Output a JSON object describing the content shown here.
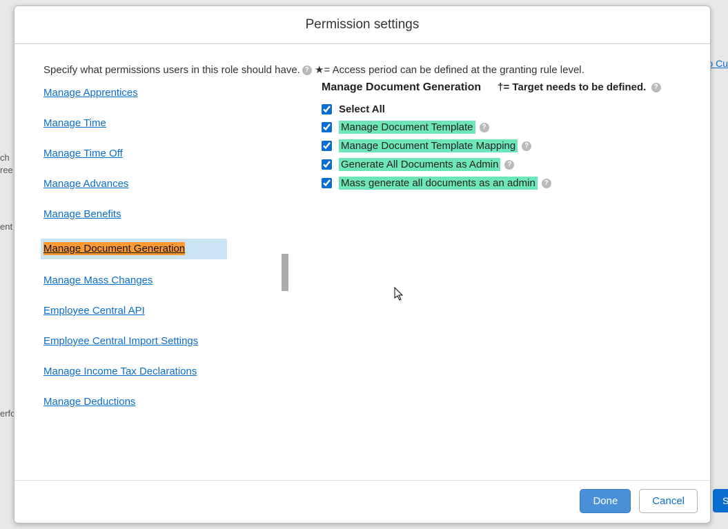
{
  "background": {
    "text_left_1": "ch",
    "text_left_2": "ree",
    "text_left_3": "ent",
    "text_left_4": "erfo",
    "link_right": "To Cu",
    "button_right": "S"
  },
  "modal": {
    "title": "Permission settings",
    "intro_prefix": "Specify what permissions users in this role should have.",
    "intro_legend": " ★= Access period can be defined at the granting rule level."
  },
  "categories": [
    {
      "label": "Manage Apprentices",
      "active": false
    },
    {
      "label": "Manage Time",
      "active": false
    },
    {
      "label": "Manage Time Off",
      "active": false
    },
    {
      "label": "Manage Advances",
      "active": false
    },
    {
      "label": "Manage Benefits",
      "active": false
    },
    {
      "label": "Manage Document Generation",
      "active": true
    },
    {
      "label": "Manage Mass Changes",
      "active": false
    },
    {
      "label": "Employee Central API",
      "active": false
    },
    {
      "label": "Employee Central Import Settings",
      "active": false
    },
    {
      "label": "Manage Income Tax Declarations",
      "active": false
    },
    {
      "label": "Manage Deductions",
      "active": false
    }
  ],
  "section": {
    "title": "Manage Document Generation",
    "note": "†= Target needs to be defined."
  },
  "permissions": [
    {
      "label": "Select All",
      "checked": true,
      "bold": true,
      "highlight": false,
      "help": false
    },
    {
      "label": "Manage Document Template",
      "checked": true,
      "bold": false,
      "highlight": true,
      "help": true
    },
    {
      "label": "Manage Document Template Mapping",
      "checked": true,
      "bold": false,
      "highlight": true,
      "help": true
    },
    {
      "label": "Generate All Documents as Admin",
      "checked": true,
      "bold": false,
      "highlight": true,
      "help": true
    },
    {
      "label": "Mass generate all documents as an admin",
      "checked": true,
      "bold": false,
      "highlight": true,
      "help": true
    }
  ],
  "footer": {
    "done": "Done",
    "cancel": "Cancel"
  }
}
